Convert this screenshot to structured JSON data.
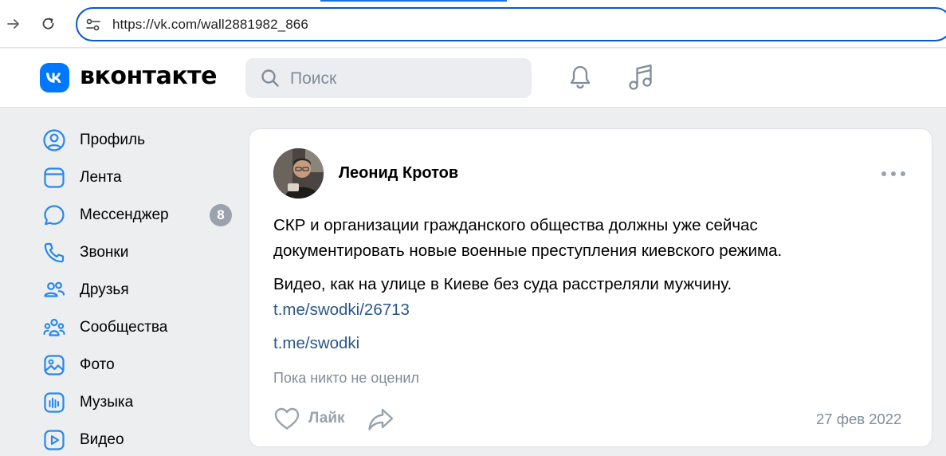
{
  "browser": {
    "url": "https://vk.com/wall2881982_866",
    "icons": {
      "forward": "forward-arrow-icon",
      "reload": "reload-icon",
      "site_info": "tune-icon"
    }
  },
  "header": {
    "logo_text": "вконтакте",
    "search_placeholder": "Поиск",
    "icons": {
      "bell": "bell-icon",
      "music": "music-icon"
    },
    "brand_color": "#0077ff"
  },
  "sidebar": {
    "items": [
      {
        "label": "Профиль",
        "icon": "profile-icon"
      },
      {
        "label": "Лента",
        "icon": "feed-icon"
      },
      {
        "label": "Мессенджер",
        "icon": "messenger-icon",
        "badge": "8"
      },
      {
        "label": "Звонки",
        "icon": "phone-icon"
      },
      {
        "label": "Друзья",
        "icon": "friends-icon"
      },
      {
        "label": "Сообщества",
        "icon": "communities-icon"
      },
      {
        "label": "Фото",
        "icon": "photo-icon"
      },
      {
        "label": "Музыка",
        "icon": "music-icon"
      },
      {
        "label": "Видео",
        "icon": "video-icon"
      }
    ]
  },
  "post": {
    "author": "Леонид Кротов",
    "paragraph1_line1": "СКР и организации гражданского общества должны уже сейчас",
    "paragraph1_line2": "документировать новые военные преступления киевского режима.",
    "paragraph2": "Видео, как на улице в Киеве без суда расстреляли мужчину.",
    "link1": "t.me/swodki/26713",
    "link2": "t.me/swodki",
    "likes_info": "Пока никто не оценил",
    "like_label": "Лайк",
    "date": "27 фев 2022",
    "link_color": "#2a5885"
  }
}
